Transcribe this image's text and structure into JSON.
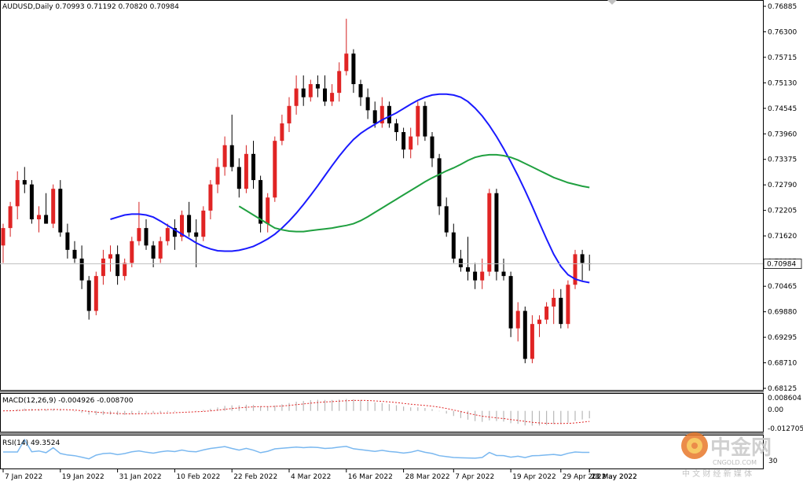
{
  "chart_data": [
    {
      "type": "candlestick",
      "title": "AUDUSD,Daily  0.70993 0.71192 0.70820 0.70984",
      "current_price_label": "0.70984",
      "ylim": [
        0.68125,
        0.76885
      ],
      "y_ticks": [
        "0.76885",
        "0.76300",
        "0.75715",
        "0.75130",
        "0.74545",
        "0.73960",
        "0.73375",
        "0.72790",
        "0.72205",
        "0.71620",
        "0.71035",
        "0.70465",
        "0.69880",
        "0.69295",
        "0.68710",
        "0.68125"
      ],
      "x_tick_labels": [
        "7 Jan 2022",
        "19 Jan 2022",
        "31 Jan 2022",
        "10 Feb 2022",
        "22 Feb 2022",
        "4 Mar 2022",
        "16 Mar 2022",
        "28 Mar 2022",
        "7 Apr 2022",
        "19 Apr 2022",
        "29 Apr 2022",
        "11 May 2022",
        "23 May 2022"
      ],
      "candles": [
        [
          0.714,
          0.719,
          0.71,
          0.718
        ],
        [
          0.718,
          0.724,
          0.716,
          0.723
        ],
        [
          0.723,
          0.731,
          0.72,
          0.729
        ],
        [
          0.729,
          0.732,
          0.726,
          0.728
        ],
        [
          0.728,
          0.729,
          0.719,
          0.72
        ],
        [
          0.72,
          0.723,
          0.717,
          0.721
        ],
        [
          0.721,
          0.726,
          0.719,
          0.719
        ],
        [
          0.719,
          0.728,
          0.718,
          0.727
        ],
        [
          0.727,
          0.729,
          0.716,
          0.717
        ],
        [
          0.717,
          0.719,
          0.711,
          0.713
        ],
        [
          0.713,
          0.715,
          0.71,
          0.711
        ],
        [
          0.711,
          0.714,
          0.704,
          0.706
        ],
        [
          0.706,
          0.707,
          0.697,
          0.699
        ],
        [
          0.699,
          0.708,
          0.698,
          0.707
        ],
        [
          0.707,
          0.713,
          0.705,
          0.711
        ],
        [
          0.711,
          0.714,
          0.708,
          0.712
        ],
        [
          0.712,
          0.714,
          0.705,
          0.707
        ],
        [
          0.707,
          0.711,
          0.706,
          0.71
        ],
        [
          0.71,
          0.716,
          0.709,
          0.715
        ],
        [
          0.715,
          0.724,
          0.714,
          0.718
        ],
        [
          0.718,
          0.72,
          0.713,
          0.714
        ],
        [
          0.714,
          0.715,
          0.709,
          0.711
        ],
        [
          0.711,
          0.716,
          0.71,
          0.715
        ],
        [
          0.715,
          0.719,
          0.714,
          0.718
        ],
        [
          0.718,
          0.72,
          0.713,
          0.716
        ],
        [
          0.716,
          0.722,
          0.715,
          0.721
        ],
        [
          0.721,
          0.724,
          0.716,
          0.717
        ],
        [
          0.717,
          0.72,
          0.709,
          0.716
        ],
        [
          0.716,
          0.723,
          0.715,
          0.722
        ],
        [
          0.722,
          0.729,
          0.72,
          0.728
        ],
        [
          0.728,
          0.734,
          0.726,
          0.732
        ],
        [
          0.732,
          0.739,
          0.73,
          0.737
        ],
        [
          0.737,
          0.744,
          0.731,
          0.732
        ],
        [
          0.732,
          0.734,
          0.725,
          0.727
        ],
        [
          0.727,
          0.737,
          0.726,
          0.735
        ],
        [
          0.735,
          0.738,
          0.727,
          0.729
        ],
        [
          0.729,
          0.73,
          0.717,
          0.719
        ],
        [
          0.719,
          0.726,
          0.717,
          0.725
        ],
        [
          0.725,
          0.739,
          0.724,
          0.738
        ],
        [
          0.738,
          0.744,
          0.737,
          0.742
        ],
        [
          0.742,
          0.748,
          0.74,
          0.746
        ],
        [
          0.746,
          0.753,
          0.744,
          0.75
        ],
        [
          0.75,
          0.753,
          0.746,
          0.748
        ],
        [
          0.748,
          0.752,
          0.747,
          0.751
        ],
        [
          0.751,
          0.753,
          0.748,
          0.75
        ],
        [
          0.75,
          0.753,
          0.746,
          0.747
        ],
        [
          0.747,
          0.751,
          0.746,
          0.749
        ],
        [
          0.749,
          0.756,
          0.747,
          0.754
        ],
        [
          0.754,
          0.766,
          0.753,
          0.758
        ],
        [
          0.758,
          0.759,
          0.749,
          0.751
        ],
        [
          0.751,
          0.752,
          0.746,
          0.748
        ],
        [
          0.748,
          0.75,
          0.743,
          0.745
        ],
        [
          0.745,
          0.747,
          0.741,
          0.742
        ],
        [
          0.742,
          0.748,
          0.741,
          0.746
        ],
        [
          0.746,
          0.747,
          0.741,
          0.742
        ],
        [
          0.742,
          0.743,
          0.738,
          0.74
        ],
        [
          0.74,
          0.741,
          0.734,
          0.736
        ],
        [
          0.736,
          0.741,
          0.734,
          0.739
        ],
        [
          0.739,
          0.747,
          0.737,
          0.746
        ],
        [
          0.746,
          0.747,
          0.738,
          0.739
        ],
        [
          0.739,
          0.74,
          0.732,
          0.734
        ],
        [
          0.734,
          0.735,
          0.721,
          0.723
        ],
        [
          0.723,
          0.725,
          0.716,
          0.717
        ],
        [
          0.717,
          0.719,
          0.71,
          0.711
        ],
        [
          0.711,
          0.713,
          0.708,
          0.709
        ],
        [
          0.709,
          0.716,
          0.706,
          0.708
        ],
        [
          0.708,
          0.71,
          0.704,
          0.706
        ],
        [
          0.706,
          0.711,
          0.704,
          0.708
        ],
        [
          0.708,
          0.727,
          0.707,
          0.726
        ],
        [
          0.726,
          0.727,
          0.706,
          0.708
        ],
        [
          0.708,
          0.711,
          0.706,
          0.707
        ],
        [
          0.707,
          0.708,
          0.693,
          0.695
        ],
        [
          0.695,
          0.701,
          0.692,
          0.699
        ],
        [
          0.699,
          0.7,
          0.687,
          0.688
        ],
        [
          0.688,
          0.698,
          0.687,
          0.696
        ],
        [
          0.696,
          0.698,
          0.693,
          0.697
        ],
        [
          0.697,
          0.701,
          0.696,
          0.7
        ],
        [
          0.7,
          0.704,
          0.696,
          0.702
        ],
        [
          0.702,
          0.704,
          0.695,
          0.696
        ],
        [
          0.696,
          0.706,
          0.695,
          0.705
        ],
        [
          0.705,
          0.713,
          0.704,
          0.712
        ],
        [
          0.712,
          0.713,
          0.706,
          0.71
        ],
        [
          0.7099,
          0.7119,
          0.7082,
          0.7098
        ]
      ],
      "series": [
        {
          "name": "",
          "color": "#1a1aff",
          "values": [
            0.72,
            0.7205,
            0.721,
            0.7212,
            0.7212,
            0.721,
            0.7205,
            0.7196,
            0.7186,
            0.7176,
            0.7166,
            0.7156,
            0.7146,
            0.7138,
            0.7132,
            0.7128,
            0.7127,
            0.7127,
            0.7129,
            0.7133,
            0.7138,
            0.7146,
            0.7155,
            0.7166,
            0.718,
            0.7196,
            0.7214,
            0.7234,
            0.7255,
            0.7277,
            0.73,
            0.7323,
            0.7345,
            0.7365,
            0.7383,
            0.7397,
            0.7408,
            0.7418,
            0.7428,
            0.7436,
            0.7444,
            0.7454,
            0.7464,
            0.7473,
            0.748,
            0.7485,
            0.7487,
            0.7487,
            0.7485,
            0.748,
            0.747,
            0.7455,
            0.7437,
            0.7415,
            0.739,
            0.7362,
            0.7332,
            0.73,
            0.7266,
            0.723,
            0.7192,
            0.7155,
            0.712,
            0.7092,
            0.7073,
            0.7063,
            0.7058,
            0.7055
          ]
        },
        {
          "name": "",
          "color": "#20a040",
          "values": [
            0.723,
            0.722,
            0.721,
            0.72,
            0.719,
            0.718,
            0.7176,
            0.7173,
            0.7172,
            0.7172,
            0.7174,
            0.7176,
            0.7178,
            0.718,
            0.7183,
            0.7186,
            0.719,
            0.7197,
            0.7206,
            0.7216,
            0.7226,
            0.7236,
            0.7246,
            0.7256,
            0.7266,
            0.7276,
            0.7286,
            0.7295,
            0.7303,
            0.7311,
            0.7318,
            0.7326,
            0.7335,
            0.7342,
            0.7346,
            0.7348,
            0.7348,
            0.7346,
            0.7342,
            0.7336,
            0.7328,
            0.732,
            0.7312,
            0.7304,
            0.7296,
            0.729,
            0.7284,
            0.728,
            0.7276,
            0.7273
          ]
        }
      ]
    },
    {
      "type": "bar",
      "title": "MACD(12,26,9) -0.004926 -0.008700",
      "y_ticks": [
        "0.008604",
        "0.00",
        "-0.012705"
      ],
      "ylim": [
        -0.0146,
        0.0108
      ]
    },
    {
      "type": "line",
      "title": "RSI(14) 49.3524",
      "series": [
        {
          "name": "",
          "color": "#7ab8f0"
        }
      ]
    }
  ],
  "watermark": {
    "name": "中金网",
    "domain": "CNGOLD.COM",
    "slogan": "中 文 财 经 新 媒 体"
  },
  "scrollbar_label": "30"
}
